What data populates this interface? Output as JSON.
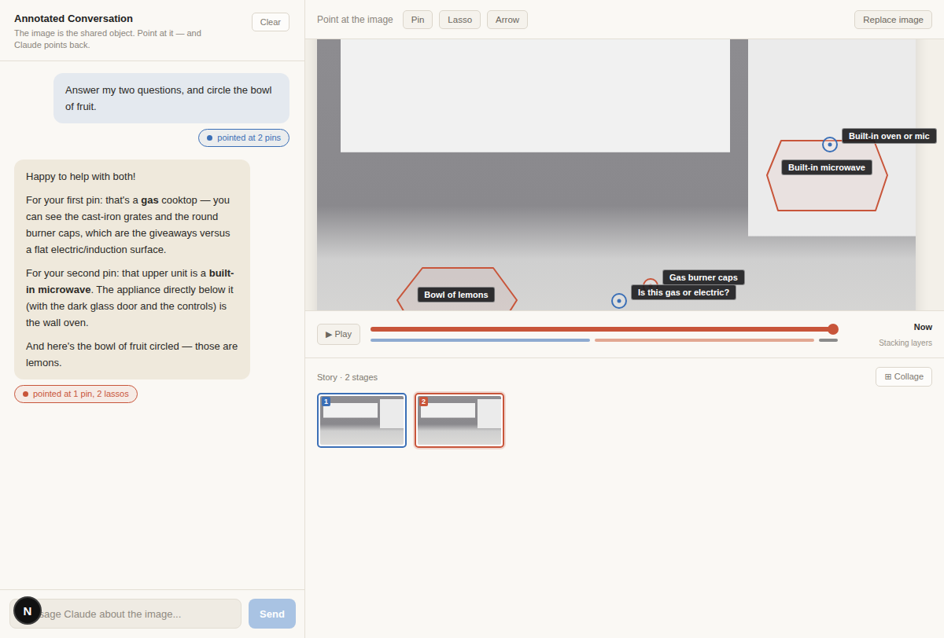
{
  "sidebar": {
    "title": "Annotated Conversation",
    "subtitle": "The image is the shared object. Point at it — and Claude points back.",
    "clear_button": "Clear"
  },
  "messages": [
    {
      "role": "user",
      "paragraphs": [
        [
          {
            "text": "Answer my two questions, and circle the bowl of fruit.",
            "bold": false
          }
        ]
      ],
      "chip": {
        "label": "pointed at 2 pins",
        "color": "#3b6fb6"
      }
    },
    {
      "role": "assistant",
      "paragraphs": [
        [
          {
            "text": "Happy to help with both!",
            "bold": false
          }
        ],
        [
          {
            "text": "For your first pin: that's a ",
            "bold": false
          },
          {
            "text": "gas",
            "bold": true
          },
          {
            "text": " cooktop — you can see the cast-iron grates and the round burner caps, which are the giveaways versus a flat electric/induction surface.",
            "bold": false
          }
        ],
        [
          {
            "text": "For your second pin: that upper unit is a ",
            "bold": false
          },
          {
            "text": "built-in microwave",
            "bold": true
          },
          {
            "text": ". The appliance directly below it (with the dark glass door and the controls) is the wall oven.",
            "bold": false
          }
        ],
        [
          {
            "text": "And here's the bowl of fruit circled — those are lemons.",
            "bold": false
          }
        ]
      ],
      "chip": {
        "label": "pointed at 1 pin, 2 lassos",
        "color": "#c8553a"
      }
    }
  ],
  "composer": {
    "placeholder": "Message Claude about the image...",
    "send": "Send",
    "send_disabled": true
  },
  "dev_badge": "N",
  "toolbar": {
    "label": "Point at the image",
    "tools": [
      {
        "label": "Pin",
        "selected": false
      },
      {
        "label": "Lasso",
        "selected": false
      },
      {
        "label": "Arrow",
        "selected": false
      }
    ],
    "replace": "Replace image"
  },
  "annotations": [
    {
      "kind": "lasso",
      "label": "Built-in microwave",
      "color": "#c8553a"
    },
    {
      "kind": "pin",
      "label": "Built-in oven or mic",
      "color": "#3b6fb6"
    },
    {
      "kind": "lasso",
      "label": "Bowl of lemons",
      "color": "#c8553a"
    },
    {
      "kind": "pin",
      "label": "Gas burner caps",
      "color": "#c8553a"
    },
    {
      "kind": "pin",
      "label": "Is this gas or electric?",
      "color": "#3b6fb6"
    }
  ],
  "timeline": {
    "play": "▶ Play",
    "level": 0.99,
    "now": "Now",
    "mode": "Stacking layers",
    "segments": [
      {
        "color": "#8eaad0",
        "level": 0.475
      },
      {
        "color": "#e2a792",
        "level": 0.475
      },
      {
        "color": "#8a8a8a",
        "level": 0.04
      }
    ]
  },
  "story": {
    "title": "Story · 2 stages",
    "collage": "⊞ Collage",
    "stages": [
      {
        "number": "1",
        "color": "#3b6fb6",
        "selected": false
      },
      {
        "number": "2",
        "color": "#c8553a",
        "selected": true
      }
    ]
  }
}
